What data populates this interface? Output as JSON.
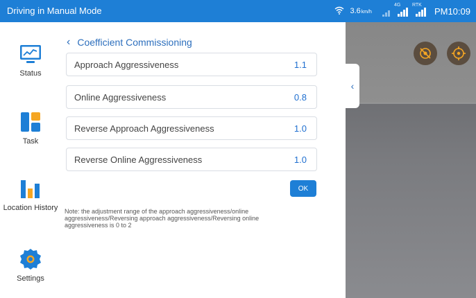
{
  "statusbar": {
    "title": "Driving in Manual Mode",
    "speed_value": "3.6",
    "speed_unit": "km/h",
    "signal2_label": "4G",
    "signal3_label": "RTK",
    "time": "PM10:09"
  },
  "sidebar": {
    "items": [
      {
        "label": "Status",
        "icon": "status-chart-icon"
      },
      {
        "label": "Task",
        "icon": "task-icon"
      },
      {
        "label": "Location History",
        "icon": "location-history-icon"
      },
      {
        "label": "Settings",
        "icon": "gear-icon"
      }
    ]
  },
  "page": {
    "back_icon": "‹",
    "title": "Coefficient Commissioning",
    "fields": [
      {
        "label": "Approach Aggressiveness",
        "value": "1.1"
      },
      {
        "label": "Online Aggressiveness",
        "value": "0.8"
      },
      {
        "label": "Reverse Approach Aggressiveness",
        "value": "1.0"
      },
      {
        "label": "Reverse Online Aggressiveness",
        "value": "1.0"
      }
    ],
    "ok_label": "OK",
    "note": "Note: the adjustment range of the approach aggressiveness/online aggressiveness/Reversing approach aggressiveness/Reversing online aggressiveness is 0 to 2"
  },
  "view": {
    "collapse_icon": "‹",
    "buttons": [
      "no-signal-icon",
      "target-icon"
    ]
  },
  "colors": {
    "accent": "#1e7fd6",
    "link": "#2d6fbd",
    "value": "#1f6fd0"
  }
}
